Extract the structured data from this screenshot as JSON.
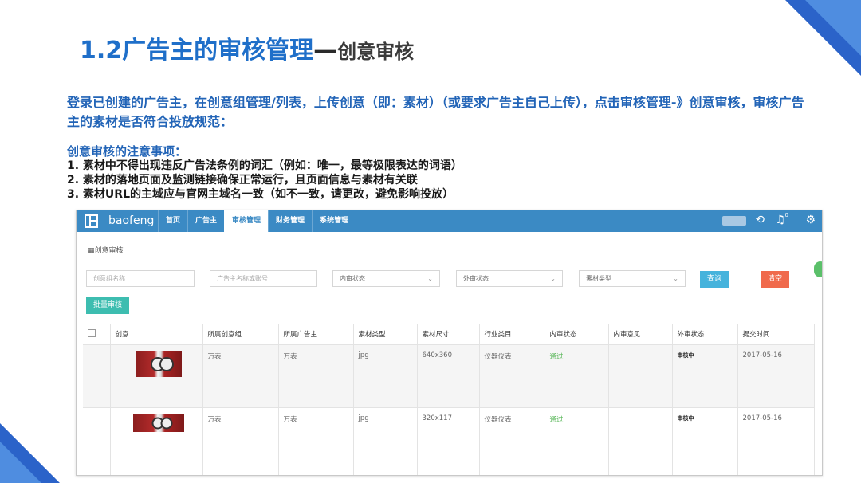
{
  "slide": {
    "title_main": "1.2广告主的审核管理",
    "title_dash": "—",
    "title_sub": "创意审核",
    "intro": "登录已创建的广告主，在创意组管理/列表，上传创意（即：素材）（或要求广告主自己上传），点击审核管理-》创意审核，审核广告主的素材是否符合投放规范：",
    "notes_heading": "创意审核的注意事项：",
    "notes": [
      "1. 素材中不得出现违反广告法条例的词汇（例如：唯一，最等极限表达的词语）",
      "2. 素材的落地页面及监测链接确保正常运行，且页面信息与素材有关联",
      "3. 素材URL的主域应与官网主域名一致（如不一致，请更改，避免影响投放）"
    ]
  },
  "app": {
    "brand": "baofeng",
    "nav": [
      "首页",
      "广告主",
      "审核管理",
      "财务管理",
      "系统管理"
    ],
    "active_nav": "审核管理",
    "badge_count": "0",
    "breadcrumb": "创意审核",
    "filters": {
      "creative_group_placeholder": "创意组名称",
      "advertiser_placeholder": "广告主名称或账号",
      "internal_status": "内审状态",
      "external_status": "外审状态",
      "material_type": "素材类型"
    },
    "buttons": {
      "query": "查询",
      "clear": "清空",
      "batch": "批量审核"
    },
    "table": {
      "headers": [
        "",
        "创意",
        "所属创意组",
        "所属广告主",
        "素材类型",
        "素材尺寸",
        "行业类目",
        "内审状态",
        "内审意见",
        "外审状态",
        "提交时间"
      ],
      "rows": [
        {
          "group": "万表",
          "advertiser": "万表",
          "type": "jpg",
          "size": "640x360",
          "industry": "仪器仪表",
          "internal_status": "通过",
          "internal_opinion": "",
          "external_status": "审核中",
          "submitted": "2017-05-16"
        },
        {
          "group": "万表",
          "advertiser": "万表",
          "type": "jpg",
          "size": "320x117",
          "industry": "仪器仪表",
          "internal_status": "通过",
          "internal_opinion": "",
          "external_status": "审核中",
          "submitted": "2017-05-16"
        }
      ]
    }
  },
  "colors": {
    "title_blue": "#1f6fc9",
    "topbar": "#3b8ac4",
    "query_button": "#46b3dc",
    "clear_button": "#f06a4c",
    "batch_button": "#3dbdb0",
    "pass_green": "#5cb85c"
  }
}
